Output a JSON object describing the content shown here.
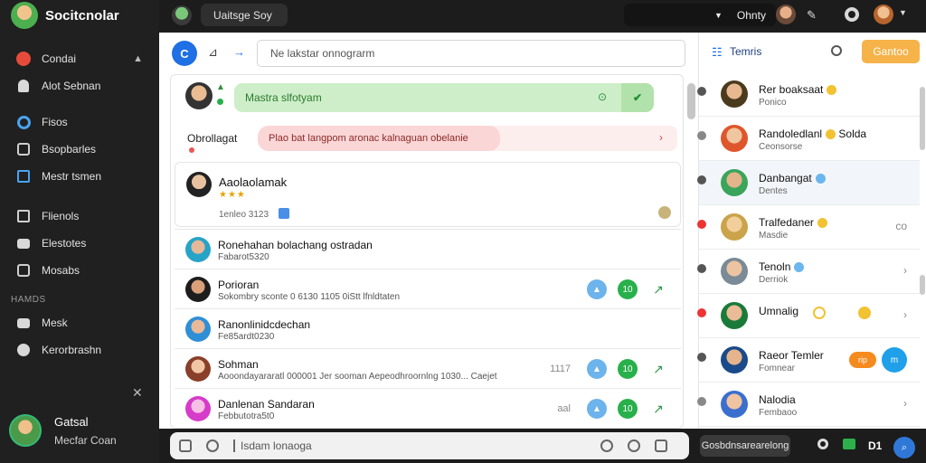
{
  "brand": {
    "name": "Socitcnolar"
  },
  "sidebar": {
    "items": [
      {
        "label": "Condai",
        "icon": "rocket-icon",
        "expandable": true
      },
      {
        "label": "Alot Sebnan",
        "icon": "person-icon"
      },
      {
        "label": "Fisos",
        "icon": "circle-icon"
      },
      {
        "label": "Bsopbarles",
        "icon": "box-icon"
      },
      {
        "label": "Mestr tsmen",
        "icon": "square-icon",
        "active": true
      },
      {
        "label": "Flienols",
        "icon": "folder-icon"
      },
      {
        "label": "Elestotes",
        "icon": "chat-icon"
      },
      {
        "label": "Mosabs",
        "icon": "grid-icon"
      }
    ],
    "section_label": "HAMDS",
    "section_items": [
      {
        "label": "Mesk",
        "icon": "bubble-icon"
      },
      {
        "label": "Kerorbrashn",
        "icon": "info-icon"
      }
    ],
    "profile": {
      "name": "Gatsal",
      "role": "Mecfar Coan"
    }
  },
  "topbar": {
    "tab": "Uaitsge Soy",
    "select": "Ohnty"
  },
  "toolbar": {
    "compose_label": "C",
    "search_placeholder": "Ne lakstar onnograrm"
  },
  "feed": {
    "top_notice": "Mastra slfotyam",
    "alert_label": "Obrollagat",
    "alert_text": "Plao bat langpom aronac kalnaguan obelanie",
    "card": {
      "name": "Aaolaolamak",
      "meta": "1enleo 3123"
    },
    "list": [
      {
        "name": "Ronehahan bolachang ostradan",
        "sub": "Fabarot5320",
        "actions": false
      },
      {
        "name": "Porioran",
        "sub": "Sokombry sconte 0 6130 1105 0iStt lfnldtaten",
        "actions": true,
        "count": "10"
      },
      {
        "name": "Ranonlinidcdechan",
        "sub": "Fe85ardt0230",
        "actions": false
      },
      {
        "name": "Sohman",
        "sub": "Aooondayararatl 000001 Jer sooman Aepeodhroornlng 1030... Caejet",
        "actions": true,
        "count": "10",
        "extra": "1117"
      },
      {
        "name": "Danlenan Sandaran",
        "sub": "Febbutotra5t0",
        "actions": true,
        "count": "10",
        "extra": "aal"
      }
    ]
  },
  "right_panel": {
    "title": "Temris",
    "filter_label": "Gantoo",
    "contacts": [
      {
        "name": "Rer boaksaat",
        "sub": "Ponico",
        "emoji": true
      },
      {
        "name": "Randoledlanl",
        "name_suffix": "Solda",
        "sub": "Ceonsorse",
        "emoji": true
      },
      {
        "name": "Danbangat",
        "sub": "Dentes",
        "verified": true,
        "selected": true
      },
      {
        "name": "Tralfedaner",
        "sub": "Masdie",
        "emoji": true,
        "chevron": "co"
      },
      {
        "name": "Tenoln",
        "sub": "Derriok",
        "verified": true
      },
      {
        "name": "Umnalig",
        "sub": "",
        "emoji": true
      },
      {
        "name": "Raeor Temler",
        "sub": "Fomnear",
        "orange_badge": "rip",
        "blue_badge": "m"
      },
      {
        "name": "Nalodia",
        "sub": "Fembaoo"
      }
    ]
  },
  "bottombar": {
    "message_placeholder": "Isdam lonaoga",
    "send_label": "Gosbdnsarearelong",
    "count": "D1"
  },
  "colors": {
    "sidebar_bg": "#202020",
    "accent_blue": "#1f6fe5",
    "accent_orange": "#f6b34a",
    "success_green": "#28b04a",
    "alert_red": "#fbd6d6"
  }
}
